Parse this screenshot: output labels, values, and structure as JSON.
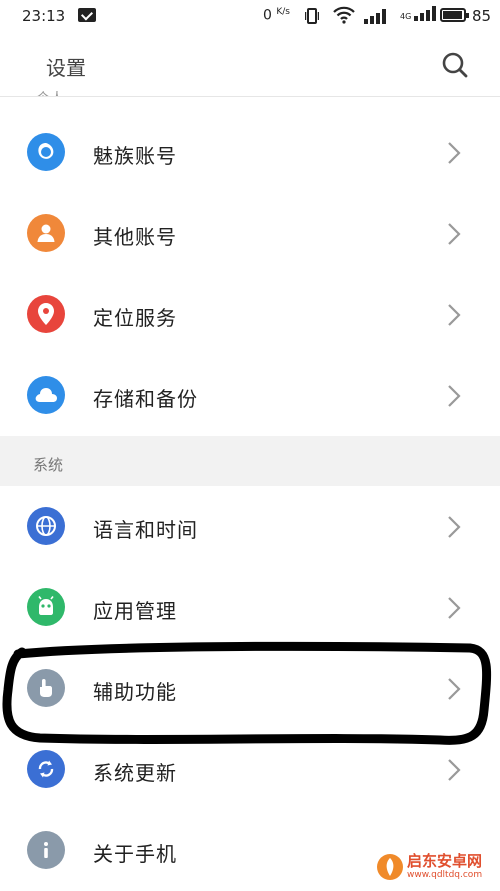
{
  "status_bar": {
    "time": "23:13",
    "net_speed": "0",
    "net_unit": "K/s",
    "network_badge": "4G",
    "battery": "85"
  },
  "app_bar": {
    "title": "设置",
    "search_icon": "search-icon"
  },
  "section_account_partial": "个人",
  "account_items": [
    {
      "label": "魅族账号",
      "icon": "flyme-icon",
      "color": "#2f8ee8"
    },
    {
      "label": "其他账号",
      "icon": "person-icon",
      "color": "#f0883a"
    },
    {
      "label": "定位服务",
      "icon": "location-pin-icon",
      "color": "#e8453c"
    },
    {
      "label": "存储和备份",
      "icon": "cloud-icon",
      "color": "#2f8ee8"
    }
  ],
  "section_system": "系统",
  "system_items": [
    {
      "label": "语言和时间",
      "icon": "globe-icon",
      "color": "#3b6fd4"
    },
    {
      "label": "应用管理",
      "icon": "android-icon",
      "color": "#2fb86a"
    },
    {
      "label": "辅助功能",
      "icon": "hand-icon",
      "color": "#8a9aaa"
    },
    {
      "label": "系统更新",
      "icon": "refresh-icon",
      "color": "#3b6fd4"
    },
    {
      "label": "关于手机",
      "icon": "info-icon",
      "color": "#8a9aaa"
    }
  ],
  "watermark": {
    "name": "启东安卓网",
    "url": "www.qdltdq.com"
  }
}
